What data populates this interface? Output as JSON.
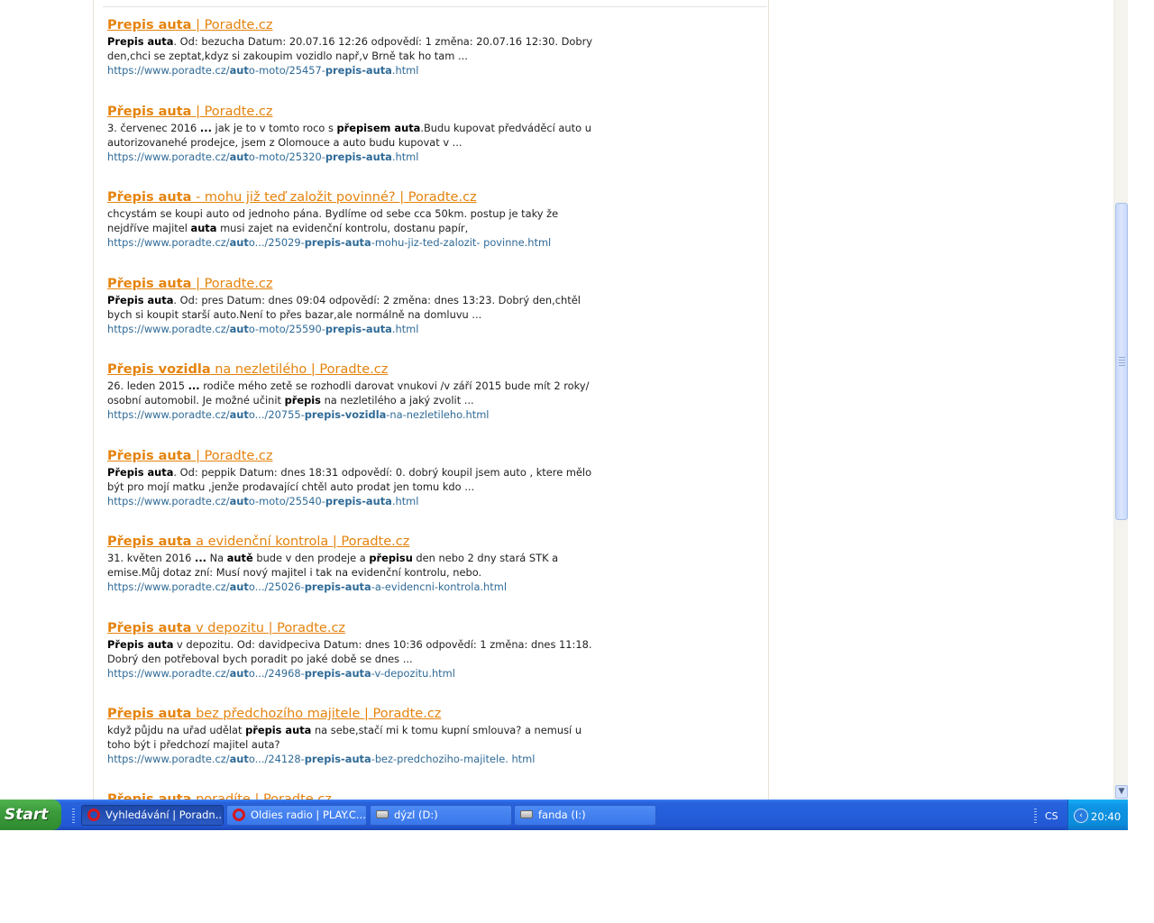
{
  "results": [
    {
      "title_bold": "Prepis auta",
      "title_rest": " | Poradte.cz",
      "snippet_lines": [
        [
          {
            "b": true,
            "t": "Prepis auta"
          },
          {
            "t": ". Od: bezucha Datum: 20.07.16 12:26 odpovědí: 1 změna: 20.07.16 12:30. Dobry"
          }
        ],
        [
          {
            "t": "den,chci se zeptat,kdyz si zakoupim vozidlo např,v Brně tak ho tam  ..."
          }
        ]
      ],
      "url_parts": [
        {
          "t": "https://www.poradte.cz/"
        },
        {
          "b": true,
          "t": "aut"
        },
        {
          "t": "o-moto/25457-"
        },
        {
          "b": true,
          "t": "prepis-auta"
        },
        {
          "t": ".html"
        }
      ]
    },
    {
      "title_bold": "Přepis auta",
      "title_rest": " | Poradte.cz",
      "snippet_lines": [
        [
          {
            "t": "3. červenec 2016 "
          },
          {
            "b": true,
            "t": "..."
          },
          {
            "t": " jak je to v tomto roco s "
          },
          {
            "b": true,
            "t": "přepisem auta"
          },
          {
            "t": ".Budu kupovat předváděcí auto u"
          }
        ],
        [
          {
            "t": "autorizovanehé prodejce, jsem z Olomouce a auto budu kupovat v ..."
          }
        ]
      ],
      "url_parts": [
        {
          "t": "https://www.poradte.cz/"
        },
        {
          "b": true,
          "t": "aut"
        },
        {
          "t": "o-moto/25320-"
        },
        {
          "b": true,
          "t": "prepis-auta"
        },
        {
          "t": ".html"
        }
      ]
    },
    {
      "title_bold": "Přepis auta",
      "title_rest": " - mohu již teď založit povinné? | Poradte.cz",
      "snippet_lines": [
        [
          {
            "t": "chcystám se koupi auto od jednoho pána. Bydlíme od sebe cca 50km. postup je taky že"
          }
        ],
        [
          {
            "t": "nejdříve majitel "
          },
          {
            "b": true,
            "t": "auta"
          },
          {
            "t": " musi zajet na evidenční kontrolu, dostanu papír,"
          }
        ]
      ],
      "url_parts": [
        {
          "t": "https://www.poradte.cz/"
        },
        {
          "b": true,
          "t": "aut"
        },
        {
          "t": "o.../25029-"
        },
        {
          "b": true,
          "t": "prepis-auta"
        },
        {
          "t": "-mohu-jiz-ted-zalozit- povinne.html"
        }
      ]
    },
    {
      "title_bold": "Přepis auta",
      "title_rest": " | Poradte.cz",
      "snippet_lines": [
        [
          {
            "b": true,
            "t": "Přepis auta"
          },
          {
            "t": ". Od: pres Datum: dnes 09:04 odpovědí: 2 změna: dnes 13:23. Dobrý den,chtěl"
          }
        ],
        [
          {
            "t": "bych si koupit starší auto.Není to přes bazar,ale normálně na domluvu ..."
          }
        ]
      ],
      "url_parts": [
        {
          "t": "https://www.poradte.cz/"
        },
        {
          "b": true,
          "t": "aut"
        },
        {
          "t": "o-moto/25590-"
        },
        {
          "b": true,
          "t": "prepis-auta"
        },
        {
          "t": ".html"
        }
      ]
    },
    {
      "title_bold": "Přepis vozidla",
      "title_rest": " na nezletilého | Poradte.cz",
      "snippet_lines": [
        [
          {
            "t": "26. leden 2015 "
          },
          {
            "b": true,
            "t": "..."
          },
          {
            "t": " rodiče mého zetě se rozhodli darovat vnukovi /v září 2015 bude mít 2 roky/"
          }
        ],
        [
          {
            "t": "osobní automobil. Je možné učinit "
          },
          {
            "b": true,
            "t": "přepis"
          },
          {
            "t": " na nezletilého a jaký zvolit ..."
          }
        ]
      ],
      "url_parts": [
        {
          "t": "https://www.poradte.cz/"
        },
        {
          "b": true,
          "t": "aut"
        },
        {
          "t": "o.../20755-"
        },
        {
          "b": true,
          "t": "prepis-vozidla"
        },
        {
          "t": "-na-nezletileho.html"
        }
      ]
    },
    {
      "title_bold": "Přepis auta",
      "title_rest": " | Poradte.cz",
      "snippet_lines": [
        [
          {
            "b": true,
            "t": "Přepis auta"
          },
          {
            "t": ". Od: peppik Datum: dnes 18:31 odpovědí: 0. dobrý koupil jsem auto , ktere mělo"
          }
        ],
        [
          {
            "t": "být pro mojí matku ,jenže prodavající chtěl auto prodat jen tomu kdo ..."
          }
        ]
      ],
      "url_parts": [
        {
          "t": "https://www.poradte.cz/"
        },
        {
          "b": true,
          "t": "aut"
        },
        {
          "t": "o-moto/25540-"
        },
        {
          "b": true,
          "t": "prepis-auta"
        },
        {
          "t": ".html"
        }
      ]
    },
    {
      "title_bold": "Přepis auta",
      "title_rest": " a evidenční kontrola | Poradte.cz",
      "snippet_lines": [
        [
          {
            "t": "31. květen 2016 "
          },
          {
            "b": true,
            "t": "..."
          },
          {
            "t": " Na "
          },
          {
            "b": true,
            "t": "autě"
          },
          {
            "t": " bude v den prodeje a "
          },
          {
            "b": true,
            "t": "přepisu"
          },
          {
            "t": " den nebo 2 dny stará STK a"
          }
        ],
        [
          {
            "t": "emise.Můj dotaz zní: Musí nový majitel i tak na evidenční kontrolu, nebo."
          }
        ]
      ],
      "url_parts": [
        {
          "t": "https://www.poradte.cz/"
        },
        {
          "b": true,
          "t": "aut"
        },
        {
          "t": "o.../25026-"
        },
        {
          "b": true,
          "t": "prepis-auta"
        },
        {
          "t": "-a-evidencni-kontrola.html"
        }
      ]
    },
    {
      "title_bold": "Přepis auta",
      "title_rest": " v depozitu | Poradte.cz",
      "snippet_lines": [
        [
          {
            "b": true,
            "t": "Přepis auta"
          },
          {
            "t": " v depozitu. Od: davidpeciva Datum: dnes 10:36 odpovědí: 1 změna: dnes 11:18."
          }
        ],
        [
          {
            "t": "Dobrý den potřeboval bych poradit po jaké době se dnes ..."
          }
        ]
      ],
      "url_parts": [
        {
          "t": "https://www.poradte.cz/"
        },
        {
          "b": true,
          "t": "aut"
        },
        {
          "t": "o.../24968-"
        },
        {
          "b": true,
          "t": "prepis-auta"
        },
        {
          "t": "-v-depozitu.html"
        }
      ]
    },
    {
      "title_bold": "Přepis auta",
      "title_rest": " bez předchozího majitele | Poradte.cz",
      "snippet_lines": [
        [
          {
            "t": "když půjdu na uřad udělat "
          },
          {
            "b": true,
            "t": "přepis auta"
          },
          {
            "t": " na sebe,stačí mi k tomu kupní smlouva? a nemusí u"
          }
        ],
        [
          {
            "t": "toho být i předchozí majitel auta?"
          }
        ]
      ],
      "url_parts": [
        {
          "t": "https://www.poradte.cz/"
        },
        {
          "b": true,
          "t": "aut"
        },
        {
          "t": "o.../24128-"
        },
        {
          "b": true,
          "t": "prepis-auta"
        },
        {
          "t": "-bez-predchoziho-majitele. html"
        }
      ]
    },
    {
      "title_bold": "Přepis auta",
      "title_rest": " poradíte | Poradte.cz",
      "snippet_lines": [],
      "url_parts": []
    }
  ],
  "taskbar": {
    "start_label": "Start",
    "tasks": [
      {
        "label": "Vyhledávání | Poradn...",
        "icon": "opera-icon",
        "active": true
      },
      {
        "label": "Oldies radio | PLAY.C...",
        "icon": "opera-icon",
        "active": false
      },
      {
        "label": "dýzl (D:)",
        "icon": "drive-icon",
        "active": false
      },
      {
        "label": "fanda (I:)",
        "icon": "drive-icon",
        "active": false
      }
    ],
    "language": "CS",
    "clock": "20:40",
    "show_hidden_icon": "chevron-left-icon"
  },
  "scrollbar": {
    "down_arrow_icon": "scroll-down-arrow-icon"
  },
  "colors": {
    "title_link": "#e5830d",
    "url_link": "#2f6a97",
    "taskbar_blue": "#245edb",
    "start_green": "#3c9c3c"
  }
}
